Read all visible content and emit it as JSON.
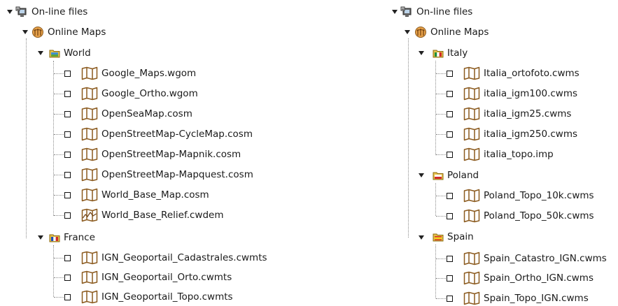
{
  "icons": {
    "computer": "computer-files-icon",
    "globe": "online-maps-icon",
    "folder": "folder-icon",
    "map": "map-file-icon",
    "relief": "relief-map-icon"
  },
  "colors": {
    "tree_lines": "#8a8a8a",
    "map_icon": "#8b5a1e",
    "globe_icon": "#c8781e"
  },
  "left_tree": {
    "root_label": "On-line files",
    "online_maps_label": "Online Maps",
    "groups": [
      {
        "label": "World",
        "items": [
          "Google_Maps.wgom",
          "Google_Ortho.wgom",
          "OpenSeaMap.cosm",
          "OpenStreetMap-CycleMap.cosm",
          "OpenStreetMap-Mapnik.cosm",
          "OpenStreetMap-Mapquest.cosm",
          "World_Base_Map.cosm",
          "World_Base_Relief.cwdem"
        ]
      },
      {
        "label": "France",
        "items": [
          "IGN_Geoportail_Cadastrales.cwmts",
          "IGN_Geoportail_Orto.cwmts",
          "IGN_Geoportail_Topo.cwmts"
        ]
      }
    ]
  },
  "right_tree": {
    "root_label": "On-line files",
    "online_maps_label": "Online Maps",
    "groups": [
      {
        "label": "Italy",
        "items": [
          "Italia_ortofoto.cwms",
          "italia_igm100.cwms",
          "italia_igm25.cwms",
          "italia_igm250.cwms",
          "italia_topo.imp"
        ]
      },
      {
        "label": "Poland",
        "items": [
          "Poland_Topo_10k.cwms",
          "Poland_Topo_50k.cwms"
        ]
      },
      {
        "label": "Spain",
        "items": [
          "Spain_Catastro_IGN.cwms",
          "Spain_Ortho_IGN.cwms",
          "Spain_Topo_IGN.cwms"
        ]
      }
    ]
  }
}
